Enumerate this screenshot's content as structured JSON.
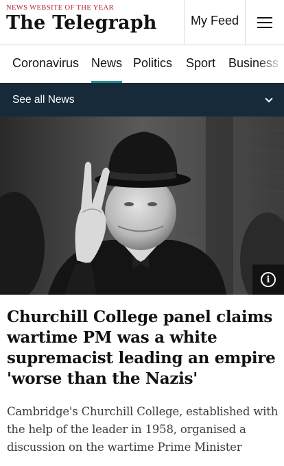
{
  "masthead": {
    "award": "NEWS WEBSITE OF THE YEAR",
    "logo": "The Telegraph",
    "my_feed": "My Feed"
  },
  "nav": {
    "tabs": [
      {
        "label": "Coronavirus",
        "active": false
      },
      {
        "label": "News",
        "active": true
      },
      {
        "label": "Politics",
        "active": false
      },
      {
        "label": "Sport",
        "active": false
      },
      {
        "label": "Business",
        "active": false
      }
    ]
  },
  "section_bar": {
    "label": "See all News"
  },
  "article": {
    "headline": "Churchill College panel claims wartime PM was a white supremacist leading an empire 'worse than the Nazis'",
    "standfirst": "Cambridge's Churchill College, established with the help of the leader in 1958, organised a discussion on the wartime Prime Minister"
  },
  "icons": {
    "menu": "hamburger-menu-icon",
    "expand": "chevron-down-icon",
    "info": "info-icon"
  },
  "colors": {
    "award_red": "#b12235",
    "section_bar_bg": "#172a3a",
    "active_tab_underline": "#2a8a8f"
  }
}
